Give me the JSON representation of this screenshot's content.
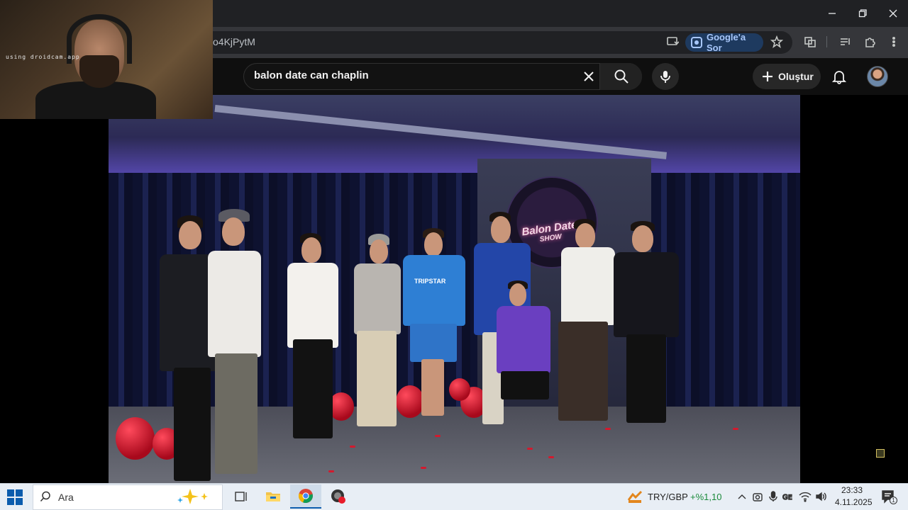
{
  "browser": {
    "url_fragment": "o4KjPytM",
    "ask_google_label": "Google'a Sor"
  },
  "youtube": {
    "search_query": "balon date can chaplin",
    "create_label": "Oluştur"
  },
  "video": {
    "sign_text_line1": "Balon Date",
    "sign_text_line2": "SHOW",
    "shirt_text": "TRIPSTAR"
  },
  "webcam": {
    "watermark": "using droidcam.app"
  },
  "taskbar": {
    "search_placeholder": "Ara",
    "currency_pair": "TRY/GBP",
    "currency_change": "+%1,10",
    "currency_change_color": "#1a8a3a",
    "time": "23:33",
    "date": "4.11.2025",
    "notification_count": "1"
  },
  "colors": {
    "chrome_titlebar": "#202124",
    "chrome_toolbar": "#35363a",
    "youtube_bg": "#0f0f0f",
    "taskbar_bg": "#e8eef5",
    "ask_google_accent": "#a8c7fa"
  }
}
